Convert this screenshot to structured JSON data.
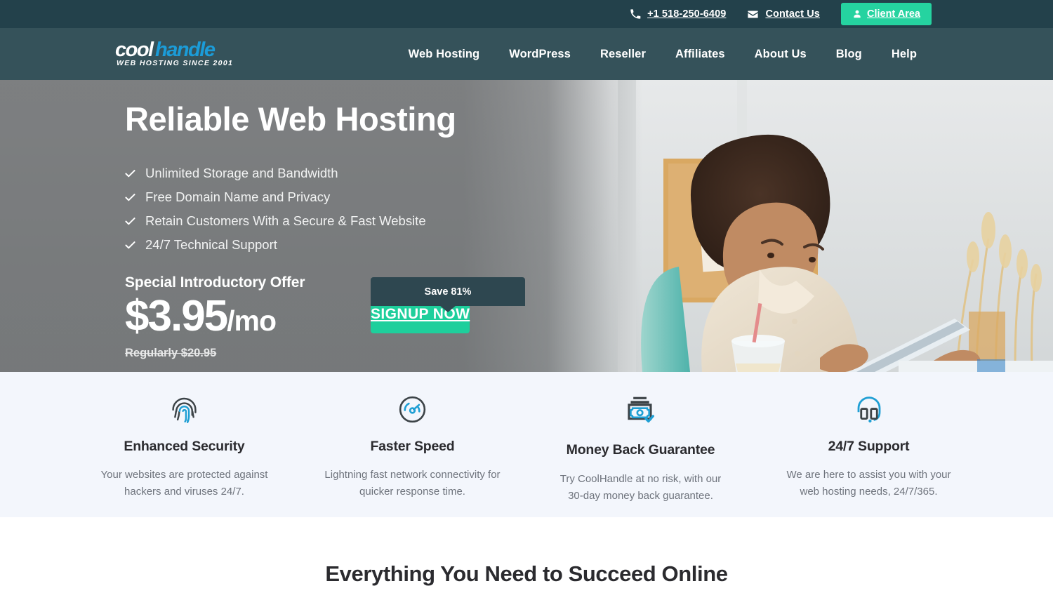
{
  "topbar": {
    "phone": "+1 518-250-6409",
    "phone_icon": "phone-icon",
    "contact_label": "Contact Us",
    "contact_icon": "envelope-icon",
    "client_area_label": "Client Area",
    "client_area_icon": "user-icon",
    "accent_color": "#25d3a0",
    "background_color": "#23414b"
  },
  "header": {
    "background_color": "#35525a",
    "logo": {
      "text_part_one": "cool",
      "text_part_two": "handle",
      "tagline": "WEB HOSTING SINCE 2001",
      "part_one_color": "#ffffff",
      "part_two_color": "#1b9cd8"
    },
    "nav": [
      {
        "label": "Web Hosting"
      },
      {
        "label": "WordPress"
      },
      {
        "label": "Reseller"
      },
      {
        "label": "Affiliates"
      },
      {
        "label": "About Us"
      },
      {
        "label": "Blog"
      },
      {
        "label": "Help"
      }
    ]
  },
  "hero": {
    "title": "Reliable Web Hosting",
    "bullets": [
      "Unlimited Storage and Bandwidth",
      "Free Domain Name and Privacy",
      "Retain Customers With a Secure & Fast Website",
      "24/7 Technical Support"
    ],
    "check_icon": "check-icon",
    "offer_title": "Special Introductory Offer",
    "price_amount": "$3.95",
    "price_period": "/mo",
    "regular_price": "Regularly $20.95",
    "save_badge": "Save 81%",
    "signup_label": "SIGNUP NOW",
    "signup_color": "#1ecf9c",
    "badge_color": "#2e4750",
    "photo_description": "Smiling woman with afro hair using a tablet at a bright office desk"
  },
  "features": {
    "background_color": "#f3f6fc",
    "items": [
      {
        "icon": "fingerprint-icon",
        "title": "Enhanced Security",
        "description": "Your websites are protected against hackers and viruses 24/7."
      },
      {
        "icon": "speedometer-icon",
        "title": "Faster Speed",
        "description": "Lightning fast network connectivity for quicker response time."
      },
      {
        "icon": "money-back-icon",
        "title": "Money Back Guarantee",
        "description": "Try CoolHandle at no risk, with our 30-day money back guarantee."
      },
      {
        "icon": "headset-icon",
        "title": "24/7 Support",
        "description": "We are here to assist you with your web hosting needs, 24/7/365."
      }
    ]
  },
  "bottom": {
    "heading": "Everything You Need to Succeed Online"
  }
}
